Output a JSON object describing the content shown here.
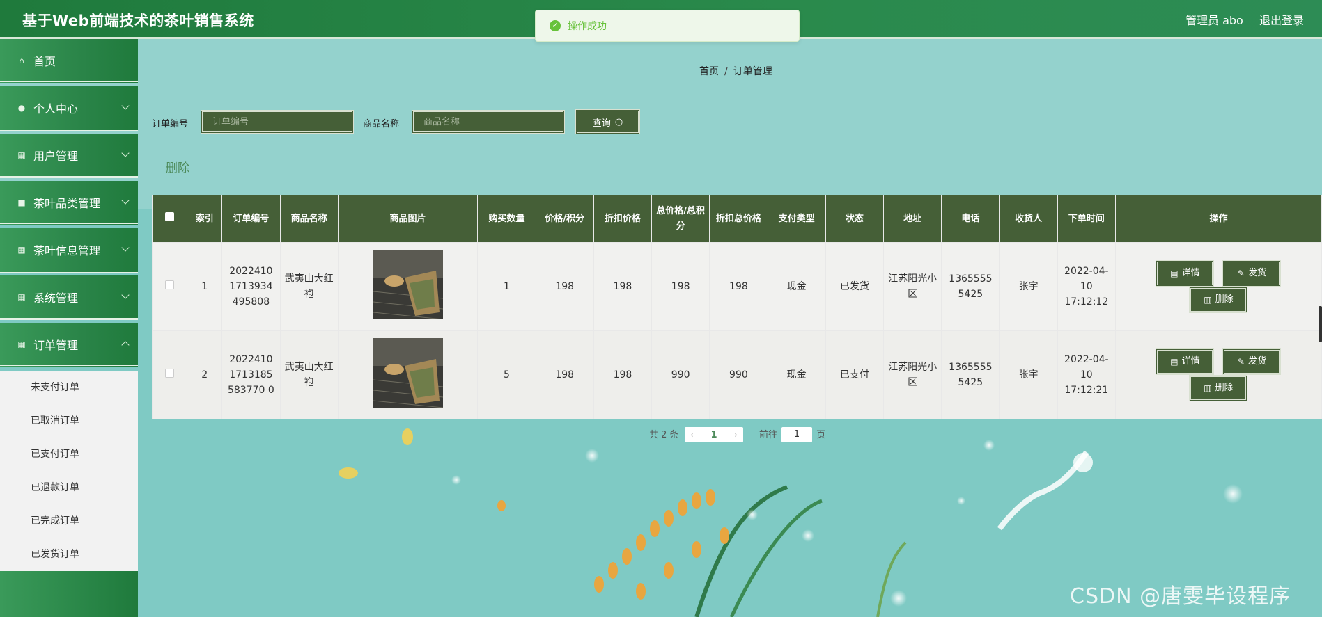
{
  "header": {
    "title": "基于Web前端技术的茶叶销售系统",
    "admin_label": "管理员 abo",
    "logout_label": "退出登录"
  },
  "toast": {
    "message": "操作成功",
    "icon": "check-circle-icon",
    "color": "#67c23a"
  },
  "sidebar": {
    "items": [
      {
        "label": "首页",
        "icon": "home-icon"
      },
      {
        "label": "个人中心",
        "icon": "user-icon"
      },
      {
        "label": "用户管理",
        "icon": "grid-icon"
      },
      {
        "label": "茶叶品类管理",
        "icon": "square-icon"
      },
      {
        "label": "茶叶信息管理",
        "icon": "grid-icon"
      },
      {
        "label": "系统管理",
        "icon": "grid-icon"
      },
      {
        "label": "订单管理",
        "icon": "grid-icon"
      }
    ],
    "submenu": [
      "未支付订单",
      "已取消订单",
      "已支付订单",
      "已退款订单",
      "已完成订单",
      "已发货订单"
    ]
  },
  "breadcrumb": {
    "home": "首页",
    "separator": "/",
    "current": "订单管理"
  },
  "search": {
    "order_no_label": "订单编号",
    "order_no_placeholder": "订单编号",
    "product_label": "商品名称",
    "product_placeholder": "商品名称",
    "query_label": "查询"
  },
  "toolbar": {
    "delete_label": "删除"
  },
  "table": {
    "headers": [
      "",
      "索引",
      "订单编号",
      "商品名称",
      "商品图片",
      "购买数量",
      "价格/积分",
      "折扣价格",
      "总价格/总积分",
      "折扣总价格",
      "支付类型",
      "状态",
      "地址",
      "电话",
      "收货人",
      "下单时间",
      "操作"
    ],
    "rows": [
      {
        "index": "1",
        "order_no": "20224101713934495808",
        "product": "武夷山大红袍",
        "qty": "1",
        "price": "198",
        "discount_price": "198",
        "total": "198",
        "discount_total": "198",
        "pay_type": "现金",
        "status": "已发货",
        "address": "江苏阳光小区",
        "phone": "13655555425",
        "receiver": "张宇",
        "time": "2022-04-10 17:12:12"
      },
      {
        "index": "2",
        "order_no": "20224101713185583770 0",
        "product": "武夷山大红袍",
        "qty": "5",
        "price": "198",
        "discount_price": "198",
        "total": "990",
        "discount_total": "990",
        "pay_type": "现金",
        "status": "已支付",
        "address": "江苏阳光小区",
        "phone": "13655555425",
        "receiver": "张宇",
        "time": "2022-04-10 17:12:21"
      }
    ],
    "actions": {
      "detail": "详情",
      "ship": "发货",
      "delete": "删除"
    }
  },
  "pagination": {
    "total": "共 2 条",
    "current": "1",
    "goto": "前往",
    "page_input": "1",
    "page_suffix": "页"
  },
  "watermark": "CSDN @唐雯毕设程序",
  "colors": {
    "header": "#1f7a3c",
    "table_header": "#455f37",
    "button": "#455f37"
  }
}
